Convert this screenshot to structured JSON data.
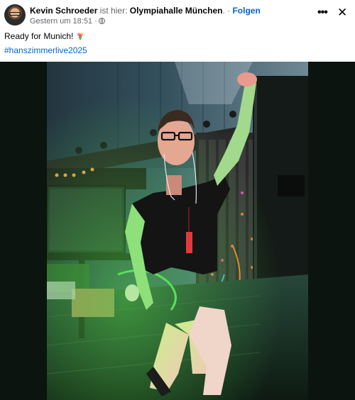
{
  "post": {
    "author": "Kevin Schroeder",
    "is_at": "ist hier:",
    "location": "Olympiahalle München",
    "separator": ". ·",
    "follow": "Folgen",
    "timestamp": "Gestern um 18:51 ·",
    "privacy_icon": "globe-icon",
    "text": "Ready for Munich!",
    "emoji": "bouquet-icon",
    "hashtag": "#hanszimmerlive2025",
    "link_color": "#0064d1"
  },
  "controls": {
    "more_icon": "more-icon",
    "close_icon": "close-icon"
  },
  "photo": {
    "subject": "man in black t-shirt and glasses standing next to synthesizer racks on stage"
  }
}
